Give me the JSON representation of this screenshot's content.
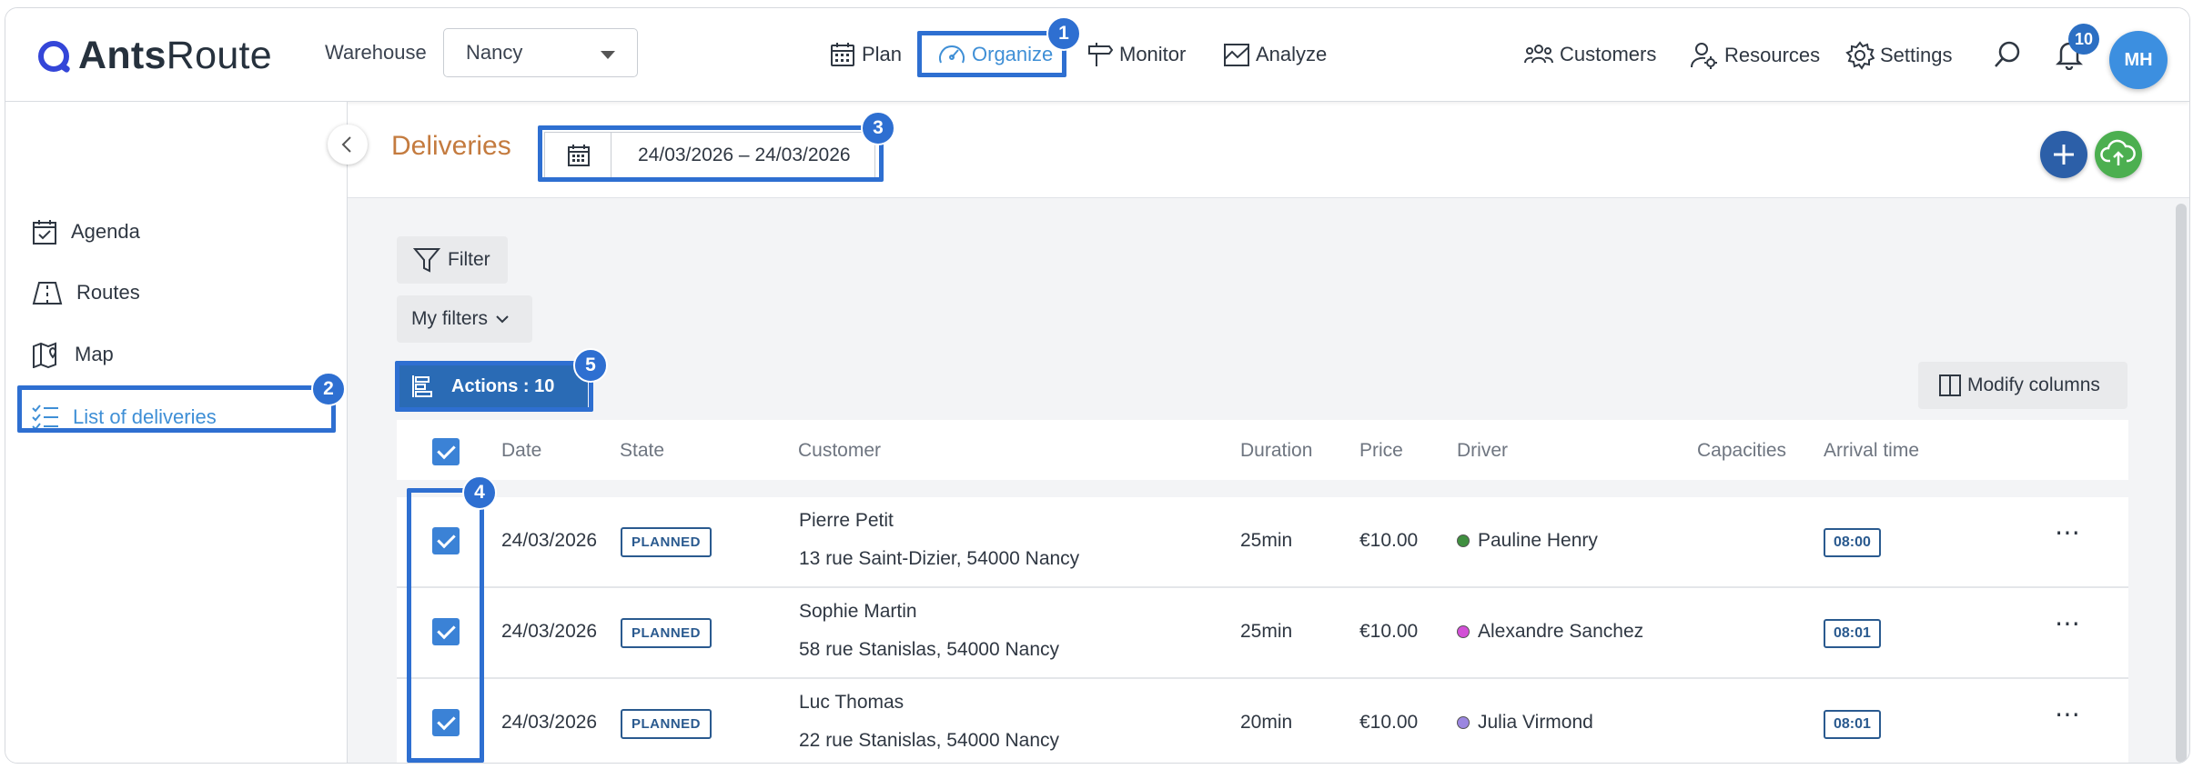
{
  "app": {
    "logo_bold": "Ants",
    "logo_light": "Route"
  },
  "topbar": {
    "warehouse_label": "Warehouse",
    "warehouse_value": "Nancy",
    "nav": {
      "plan": "Plan",
      "organize": "Organize",
      "monitor": "Monitor",
      "analyze": "Analyze"
    },
    "right": {
      "customers": "Customers",
      "resources": "Resources",
      "settings": "Settings"
    },
    "notification_count": "10",
    "avatar_initials": "MH"
  },
  "sidebar": {
    "items": [
      {
        "label": "Agenda",
        "icon": "calendar-check-icon"
      },
      {
        "label": "Routes",
        "icon": "road-icon"
      },
      {
        "label": "Map",
        "icon": "map-pin-icon"
      },
      {
        "label": "List of deliveries",
        "icon": "checklist-icon",
        "active": true
      }
    ]
  },
  "header": {
    "title": "Deliveries",
    "date_range": "24/03/2026 – 24/03/2026"
  },
  "toolbar": {
    "filter": "Filter",
    "my_filters": "My filters",
    "actions": "Actions : 10",
    "modify_columns": "Modify columns"
  },
  "table": {
    "columns": [
      "Date",
      "State",
      "Customer",
      "Duration",
      "Price",
      "Driver",
      "Capacities",
      "Arrival time"
    ],
    "rows": [
      {
        "date": "24/03/2026",
        "state": "PLANNED",
        "customer": "Pierre Petit",
        "address": "13 rue Saint-Dizier, 54000 Nancy",
        "duration": "25min",
        "price": "€10.00",
        "driver": "Pauline Henry",
        "driver_color": "#3f8f3f",
        "arrival": "08:00"
      },
      {
        "date": "24/03/2026",
        "state": "PLANNED",
        "customer": "Sophie Martin",
        "address": "58 rue Stanislas, 54000 Nancy",
        "duration": "25min",
        "price": "€10.00",
        "driver": "Alexandre Sanchez",
        "driver_color": "#d24fd6",
        "arrival": "08:01"
      },
      {
        "date": "24/03/2026",
        "state": "PLANNED",
        "customer": "Luc Thomas",
        "address": "22 rue Stanislas, 54000 Nancy",
        "duration": "20min",
        "price": "€10.00",
        "driver": "Julia Virmond",
        "driver_color": "#9b86e0",
        "arrival": "08:01"
      }
    ]
  },
  "annotations": [
    "1",
    "2",
    "3",
    "4",
    "5"
  ],
  "colors": {
    "highlight": "#2e6fd1",
    "accent": "#3f8fd6",
    "title": "#c47b3f",
    "add_button": "#2c5fa8",
    "upload_button": "#4caf50"
  }
}
